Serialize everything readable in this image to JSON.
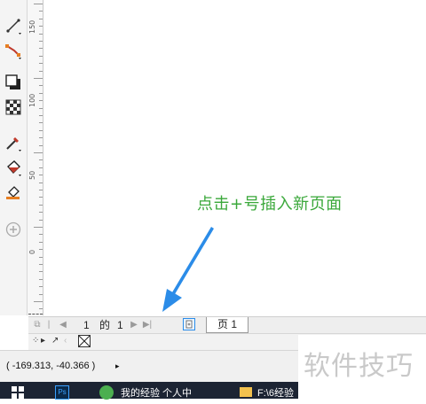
{
  "annotation": {
    "text": "点击+号插入新页面"
  },
  "ruler": {
    "labels": [
      "150",
      "100",
      "50",
      "0"
    ]
  },
  "page_nav": {
    "current": "1",
    "of_label": "的",
    "total": "1",
    "tab_label": "页 1"
  },
  "status": {
    "coordinates": "( -169.313, -40.366 )",
    "arrow": "▸"
  },
  "watermark": {
    "text": "软件技巧"
  },
  "taskbar": {
    "items": [
      {
        "label": "我的经验 个人中"
      },
      {
        "label": "F:\\6经验"
      }
    ]
  },
  "colors": {
    "annotation": "#3aa83a",
    "arrow": "#2b8ce8",
    "taskbar": "#1c2433"
  },
  "icons": [
    "line-tool-icon",
    "connector-tool-icon",
    "shadow-tool-icon",
    "transparency-tool-icon",
    "eyedropper-tool-icon",
    "fill-tool-icon",
    "smart-fill-tool-icon",
    "add-tool-icon"
  ]
}
